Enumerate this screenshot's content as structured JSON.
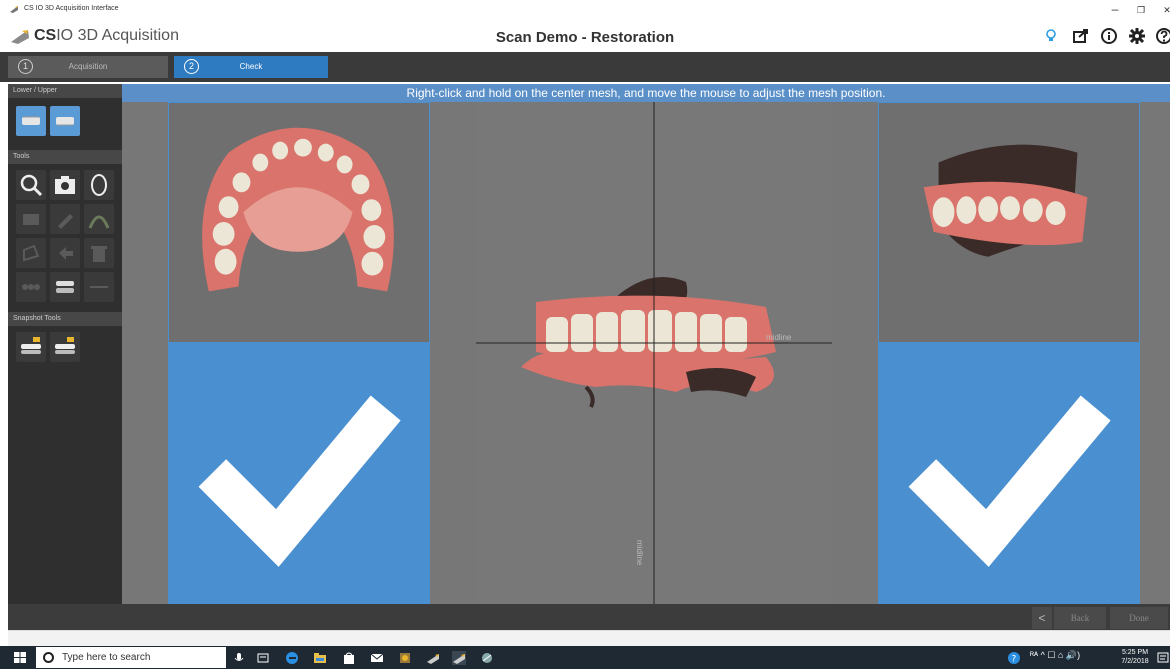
{
  "window": {
    "title": "CS IO 3D Acquisition Interface",
    "min": "–",
    "restore": "❐",
    "close": "✕"
  },
  "header": {
    "brand_bold": "CS",
    "brand_rest": "IO 3D Acquisition",
    "title": "Scan Demo - Restoration"
  },
  "steps": [
    {
      "num": "1",
      "label": "Acquisition"
    },
    {
      "num": "2",
      "label": "Check"
    }
  ],
  "left_panel": {
    "sections": {
      "jaw": "Lower / Upper",
      "tools": "Tools",
      "snapshot": "Snapshot Tools"
    }
  },
  "banner": "Right-click and hold on the center mesh, and move the mouse to adjust the mesh position.",
  "viewport": {
    "midline_h": "midline",
    "midline_v": "midline"
  },
  "bottom": {
    "back": "Back",
    "done": "Done",
    "left_arrow": "<"
  },
  "taskbar": {
    "search_placeholder": "Type here to search",
    "clock_time": "5:25 PM",
    "clock_date": "7/2/2018",
    "tray_text": "ᴿᴬ ^ ☐ ⌂ 🔊)"
  },
  "colors": {
    "accent": "#2f7bc2",
    "banner": "#5a8fc7",
    "gum": "#d9736b",
    "tooth": "#e8e4d8"
  }
}
